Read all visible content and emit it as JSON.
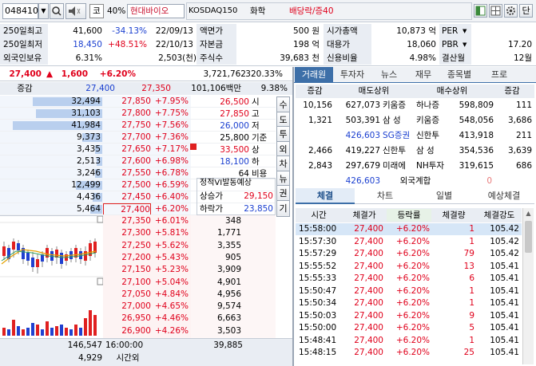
{
  "toolbar": {
    "code": "048410",
    "market": "코",
    "margin": "40%",
    "name": "현대바이오",
    "index": "KOSDAQ150",
    "sector": "화학",
    "status": "배당락/증40"
  },
  "info": {
    "r1": {
      "l1": "250일최고",
      "h": "41,600",
      "hp": "-34.13%",
      "hd": "22/09/13",
      "l2": "액면가",
      "v2": "500 원",
      "l3": "시가총액",
      "v3": "10,873 억",
      "l4": "PER",
      "v4": ""
    },
    "r2": {
      "l1": "250일최저",
      "lo": "18,450",
      "lp": "+48.51%",
      "ld": "22/10/13",
      "l2": "자본금",
      "v2": "198 억",
      "l3": "대용가",
      "v3": "18,060",
      "l4": "PBR",
      "v4": "17.20"
    },
    "r3": {
      "l1": "외국인보유",
      "fr": "6.31%",
      "fq": "2,503(천)",
      "l2": "주식수",
      "v2": "39,683 천",
      "l3": "신용비율",
      "v3": "4.98%",
      "l4": "결산월",
      "v4": "12월"
    }
  },
  "price": {
    "cur": "27,400",
    "arrow": "▲",
    "chg": "1,600",
    "pct": "+6.20%",
    "vol": "3,721,762",
    "ratio": "320.33%"
  },
  "ob_head": {
    "left": "증감",
    "ask": "27,400",
    "bid": "27,350",
    "amt": "101,106백만",
    "pct": "9.38%"
  },
  "asks": [
    {
      "q": "32,494",
      "p": "27,850",
      "pc": "+7.95%"
    },
    {
      "q": "31,103",
      "p": "27,800",
      "pc": "+7.75%"
    },
    {
      "q": "41,984",
      "p": "27,750",
      "pc": "+7.56%"
    },
    {
      "q": "9,373",
      "p": "27,700",
      "pc": "+7.36%"
    },
    {
      "q": "3,435",
      "p": "27,650",
      "pc": "+7.17%"
    },
    {
      "q": "2,513",
      "p": "27,600",
      "pc": "+6.98%"
    },
    {
      "q": "3,246",
      "p": "27,550",
      "pc": "+6.78%"
    },
    {
      "q": "12,499",
      "p": "27,500",
      "pc": "+6.59%"
    },
    {
      "q": "4,436",
      "p": "27,450",
      "pc": "+6.40%"
    },
    {
      "q": "5,464",
      "p": "27,400",
      "pc": "+6.20%"
    }
  ],
  "bids": [
    {
      "p": "27,350",
      "pc": "+6.01%",
      "q": "348"
    },
    {
      "p": "27,300",
      "pc": "+5.81%",
      "q": "1,771"
    },
    {
      "p": "27,250",
      "pc": "+5.62%",
      "q": "3,355"
    },
    {
      "p": "27,200",
      "pc": "+5.43%",
      "q": "905"
    },
    {
      "p": "27,150",
      "pc": "+5.23%",
      "q": "3,909"
    },
    {
      "p": "27,100",
      "pc": "+5.04%",
      "q": "4,901"
    },
    {
      "p": "27,050",
      "pc": "+4.84%",
      "q": "4,956"
    },
    {
      "p": "27,000",
      "pc": "+4.65%",
      "q": "9,574"
    },
    {
      "p": "26,950",
      "pc": "+4.46%",
      "q": "6,663"
    },
    {
      "p": "26,900",
      "pc": "+4.26%",
      "q": "3,503"
    }
  ],
  "summary": [
    {
      "v": "26,500",
      "l": "시"
    },
    {
      "v": "27,850",
      "l": "고"
    },
    {
      "v": "26,000",
      "l": "저"
    },
    {
      "v": "25,800",
      "l": "기준"
    },
    {
      "v": "33,500",
      "l": "상"
    },
    {
      "v": "18,100",
      "l": "하"
    },
    {
      "v": "64",
      "l": "비용"
    }
  ],
  "vi": {
    "title": "정적VI발동예상",
    "up_l": "상승가",
    "up_v": "29,150",
    "dn_l": "하락가",
    "dn_v": "23,850"
  },
  "side_btns": [
    "수",
    "도",
    "투",
    "외",
    "차",
    "뉴",
    "권",
    "기"
  ],
  "ob_foot": {
    "ask_tot": "146,547",
    "time": "16:00:00",
    "bid_tot": "39,885",
    "aft": "4,929",
    "aft_l": "시간외"
  },
  "right_tabs": [
    "거래원",
    "투자자",
    "뉴스",
    "재무",
    "종목별",
    "프로"
  ],
  "broker_head": [
    "증감",
    "매도상위",
    "매수상위",
    "증감"
  ],
  "brokers": [
    {
      "c1": "10,156",
      "sq": "627,073",
      "sn": "키움증",
      "bn": "하나증",
      "bq": "598,809",
      "c2": "111"
    },
    {
      "c1": "1,321",
      "sq": "503,391",
      "sn": "삼 성",
      "bn": "키움증",
      "bq": "548,056",
      "c2": "3,686"
    },
    {
      "c1": "",
      "sq": "426,603",
      "sn": "SG증권",
      "bn": "신한투",
      "bq": "413,918",
      "c2": "211"
    },
    {
      "c1": "2,466",
      "sq": "419,227",
      "sn": "신한투",
      "bn": "삼 성",
      "bq": "354,536",
      "c2": "3,639"
    },
    {
      "c1": "2,843",
      "sq": "297,679",
      "sn": "미래에",
      "bn": "NH투자",
      "bq": "319,615",
      "c2": "686"
    }
  ],
  "foreign": {
    "q": "426,603",
    "l": "외국계합",
    "v": "0"
  },
  "trade_tabs": [
    "체결",
    "차트",
    "일별",
    "예상체결"
  ],
  "trade_head": [
    "시간",
    "체결가",
    "등락률",
    "체결량",
    "체결강도"
  ],
  "trades": [
    {
      "t": "15:58:00",
      "p": "27,400",
      "r": "+6.20%",
      "q": "1",
      "s": "105.42"
    },
    {
      "t": "15:57:30",
      "p": "27,400",
      "r": "+6.20%",
      "q": "1",
      "s": "105.42"
    },
    {
      "t": "15:57:29",
      "p": "27,400",
      "r": "+6.20%",
      "q": "79",
      "s": "105.42"
    },
    {
      "t": "15:55:52",
      "p": "27,400",
      "r": "+6.20%",
      "q": "13",
      "s": "105.41"
    },
    {
      "t": "15:55:33",
      "p": "27,400",
      "r": "+6.20%",
      "q": "6",
      "s": "105.41"
    },
    {
      "t": "15:50:47",
      "p": "27,400",
      "r": "+6.20%",
      "q": "1",
      "s": "105.41"
    },
    {
      "t": "15:50:34",
      "p": "27,400",
      "r": "+6.20%",
      "q": "1",
      "s": "105.41"
    },
    {
      "t": "15:50:03",
      "p": "27,400",
      "r": "+6.20%",
      "q": "9",
      "s": "105.41"
    },
    {
      "t": "15:50:00",
      "p": "27,400",
      "r": "+6.20%",
      "q": "5",
      "s": "105.41"
    },
    {
      "t": "15:48:41",
      "p": "27,400",
      "r": "+6.20%",
      "q": "1",
      "s": "105.41"
    },
    {
      "t": "15:48:15",
      "p": "27,400",
      "r": "+6.20%",
      "q": "25",
      "s": "105.41"
    }
  ],
  "win_btns": {
    "close": "단"
  }
}
